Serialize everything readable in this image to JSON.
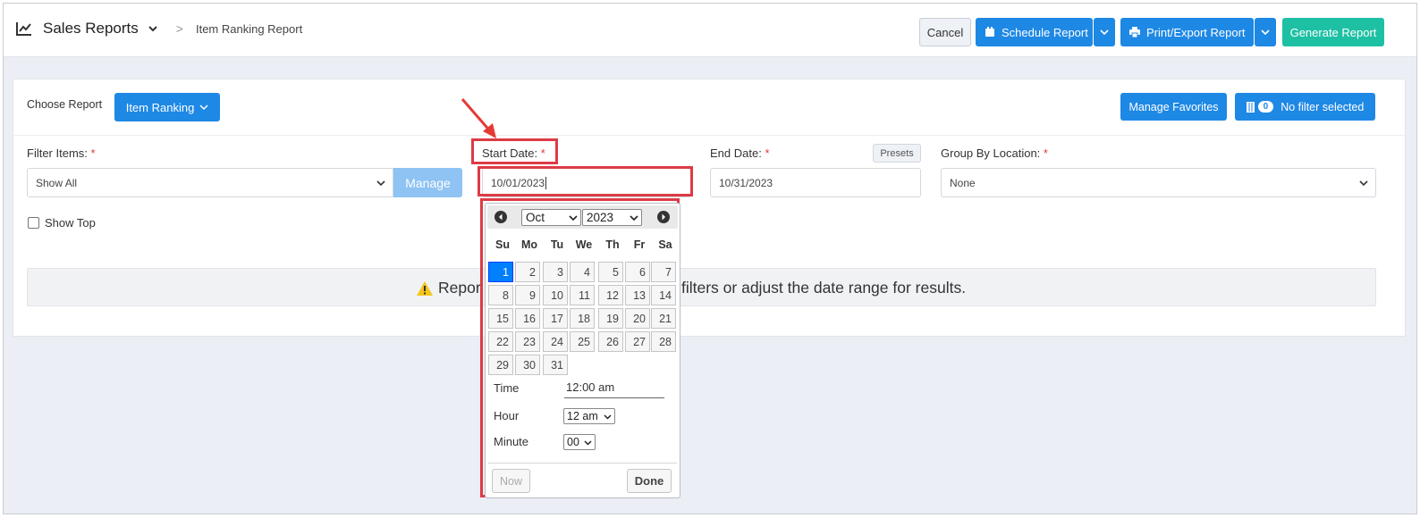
{
  "header": {
    "app_title": "Sales Reports",
    "breadcrumb_separator": ">",
    "breadcrumb_current": "Item Ranking Report",
    "buttons": {
      "cancel": "Cancel",
      "schedule": "Schedule Report",
      "print_export": "Print/Export Report",
      "generate": "Generate Report"
    }
  },
  "report_bar": {
    "choose_label": "Choose Report",
    "report_dropdown": "Item Ranking",
    "manage_favorites": "Manage Favorites",
    "filter_count": "0",
    "filter_status": "No filter selected"
  },
  "filters": {
    "filter_items_label": "Filter Items:",
    "filter_items_value": "Show All",
    "manage_button": "Manage",
    "start_date_label": "Start Date:",
    "start_date_value": "10/01/2023",
    "end_date_label": "End Date:",
    "end_date_value": "10/31/2023",
    "presets_button": "Presets",
    "group_by_label": "Group By Location:",
    "group_by_value": "None",
    "required_mark": "*",
    "show_top_label": "Show Top",
    "show_top_checked": false
  },
  "alert": {
    "text_left": "Repor",
    "text_right": "filters or adjust the date range for results."
  },
  "datepicker": {
    "month": "Oct",
    "year": "2023",
    "weekdays": [
      "Su",
      "Mo",
      "Tu",
      "We",
      "Th",
      "Fr",
      "Sa"
    ],
    "weeks": [
      [
        "1",
        "2",
        "3",
        "4",
        "5",
        "6",
        "7"
      ],
      [
        "8",
        "9",
        "10",
        "11",
        "12",
        "13",
        "14"
      ],
      [
        "15",
        "16",
        "17",
        "18",
        "19",
        "20",
        "21"
      ],
      [
        "22",
        "23",
        "24",
        "25",
        "26",
        "27",
        "28"
      ],
      [
        "29",
        "30",
        "31"
      ]
    ],
    "selected_day": "1",
    "time_label": "Time",
    "time_value": "12:00 am",
    "hour_label": "Hour",
    "hour_value": "12 am",
    "minute_label": "Minute",
    "minute_value": "00",
    "now_button": "Now",
    "done_button": "Done"
  },
  "colors": {
    "primary": "#1e88e5",
    "generate": "#1ec0a4",
    "highlight": "#dc3b45",
    "selected_day": "#007fff"
  },
  "icons": {
    "title": "line-chart-icon",
    "schedule": "calendar-icon",
    "print": "printer-icon",
    "filter": "filter-icon",
    "alert": "warning-icon"
  }
}
